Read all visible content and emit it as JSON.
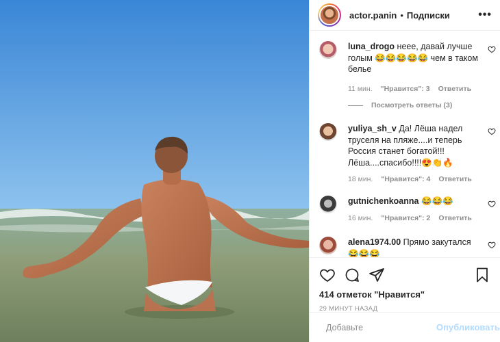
{
  "header": {
    "username": "actor.panin",
    "separator": "•",
    "follow_label": "Подписки",
    "more_icon": "more-horizontal-icon"
  },
  "comments": [
    {
      "username": "luna_drogo",
      "text": "неее, давай лучше голым 😂😂😂😂😂 чем в таком белье",
      "time": "11 мин.",
      "likes": "\"Нравится\": 3",
      "reply": "Ответить",
      "view_replies": "Посмотреть ответы (3)"
    },
    {
      "username": "yuliya_sh_v",
      "text": "Да! Лёша надел труселя на пляже....и теперь Россия станет богатой!!! Лёша....спасибо!!!!😍👏🔥",
      "time": "18 мин.",
      "likes": "\"Нравится\": 4",
      "reply": "Ответить"
    },
    {
      "username": "gutnichenkoanna",
      "text": "😂😂😂",
      "time": "16 мин.",
      "likes": "\"Нравится\": 2",
      "reply": "Ответить"
    },
    {
      "username": "alena1974.00",
      "text": "Прямо закутался 😂😂😂"
    }
  ],
  "post": {
    "likes_text": "414 отметок \"Нравится\"",
    "time_ago": "29 МИНУТ НАЗАД"
  },
  "add_comment": {
    "placeholder": "Добавьте",
    "post_label": "Опубликовать"
  },
  "colors": {
    "sky": "#3d8ad9",
    "sea": "#7e9a7d",
    "link_disabled": "#b3dbff",
    "muted": "#8e8e8e"
  }
}
